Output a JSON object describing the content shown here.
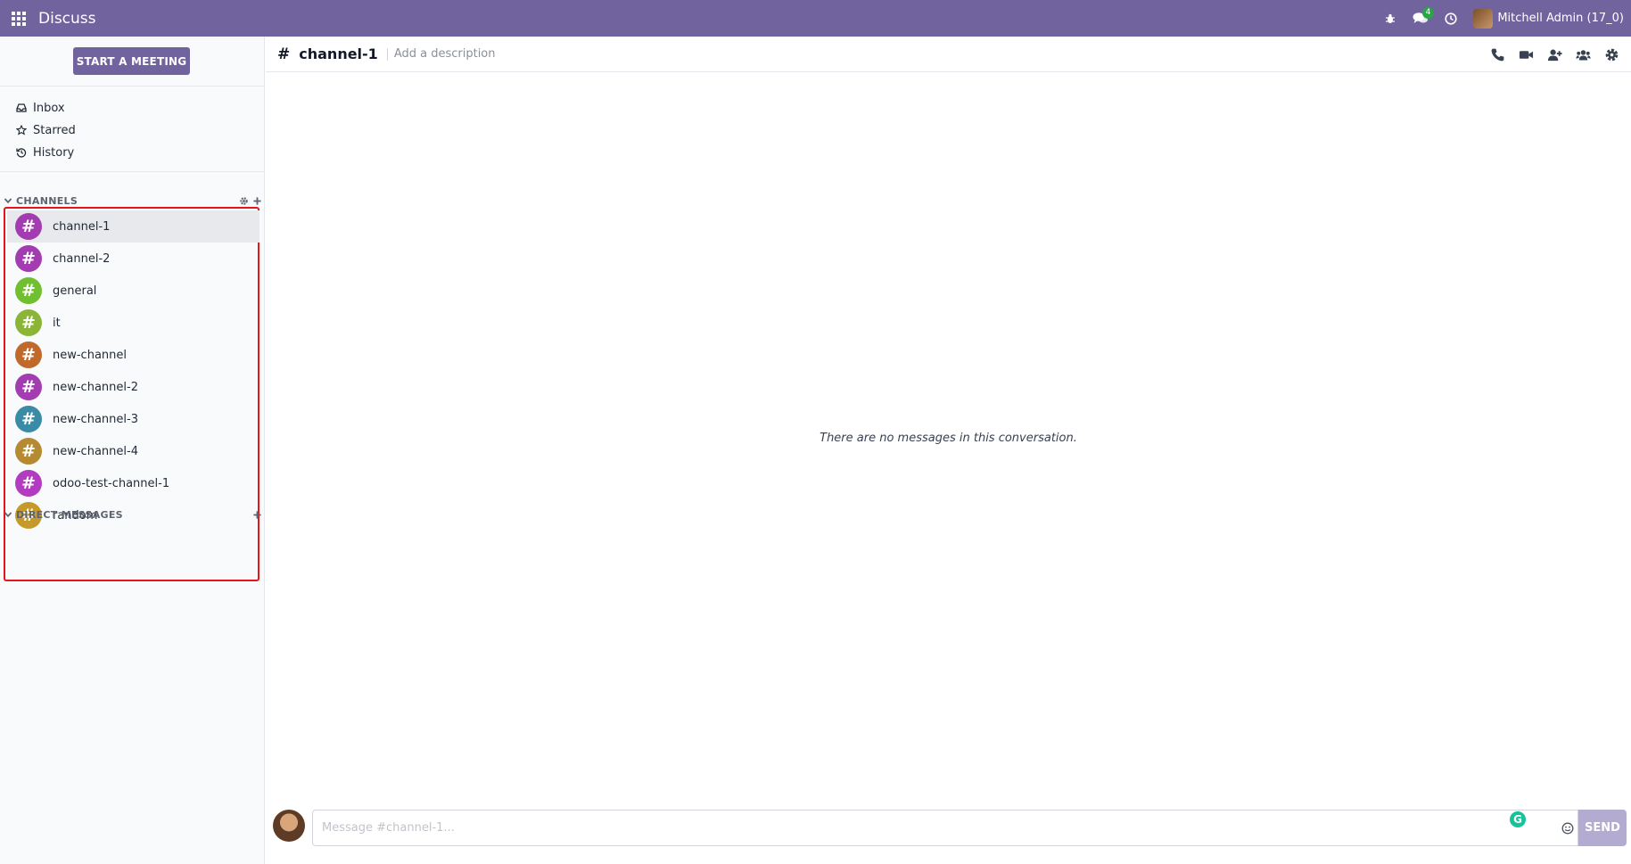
{
  "navbar": {
    "app_name": "Discuss",
    "messages_badge": "4",
    "user_name": "Mitchell Admin (17_0)"
  },
  "sidebar": {
    "start_meeting_label": "START A MEETING",
    "mailboxes": [
      {
        "label": "Inbox",
        "icon": "inbox-icon"
      },
      {
        "label": "Starred",
        "icon": "star-icon"
      },
      {
        "label": "History",
        "icon": "history-icon"
      }
    ],
    "channels_header": "CHANNELS",
    "channels": [
      {
        "name": "channel-1",
        "color": "#a33cb0",
        "active": true
      },
      {
        "name": "channel-2",
        "color": "#a33cb0",
        "active": false
      },
      {
        "name": "general",
        "color": "#6fbf2e",
        "active": false
      },
      {
        "name": "it",
        "color": "#8bb536",
        "active": false
      },
      {
        "name": "new-channel",
        "color": "#c0692c",
        "active": false
      },
      {
        "name": "new-channel-2",
        "color": "#a33cb0",
        "active": false
      },
      {
        "name": "new-channel-3",
        "color": "#3a8ca6",
        "active": false
      },
      {
        "name": "new-channel-4",
        "color": "#b58a30",
        "active": false
      },
      {
        "name": "odoo-test-channel-1",
        "color": "#b23cbf",
        "active": false
      },
      {
        "name": "random",
        "color": "#c59a2a",
        "active": false
      }
    ],
    "direct_messages_header": "DIRECT MESSAGES"
  },
  "thread": {
    "hash": "#",
    "name": "channel-1",
    "description_placeholder": "Add a description",
    "empty_message": "There are no messages in this conversation."
  },
  "composer": {
    "placeholder": "Message #channel-1...",
    "grammarly_letter": "G",
    "send_label": "SEND"
  },
  "colors": {
    "brand": "#71639e",
    "highlight_border": "#e5151b"
  }
}
